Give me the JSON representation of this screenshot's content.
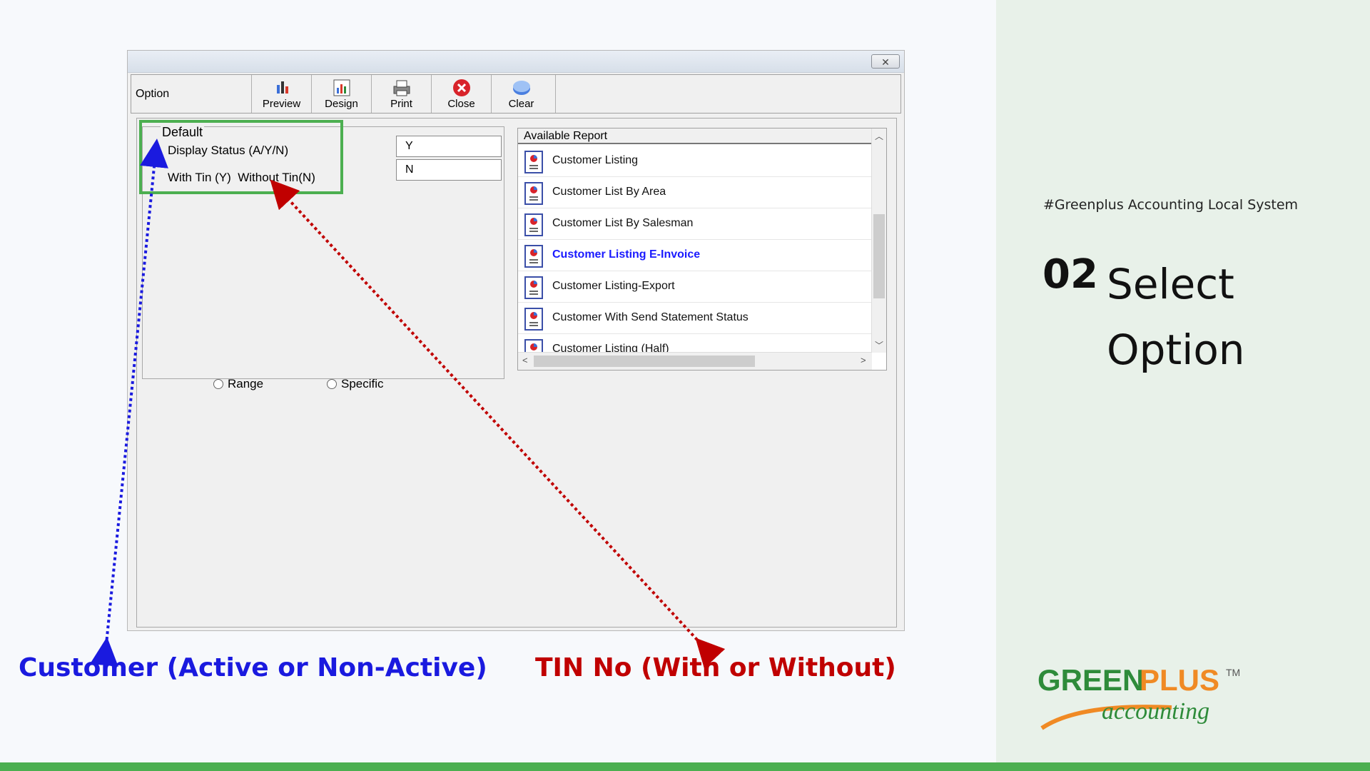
{
  "slide": {
    "hashtag": "#Greenplus Accounting Local System",
    "step_number": "02",
    "step_title_line1": "Select",
    "step_title_line2": "Option",
    "logo_brand_green": "GREEN",
    "logo_brand_plus": "PLUS",
    "logo_tm": "TM",
    "logo_subtitle": "accounting",
    "callout_left": "Customer (Active or Non-Active)",
    "callout_right": "TIN No (With or Without)"
  },
  "window": {
    "close_icon": "close-icon"
  },
  "toolbar": {
    "label": "Option",
    "buttons": [
      {
        "label": "Preview",
        "icon": "preview-chart-icon"
      },
      {
        "label": "Design",
        "icon": "design-icon"
      },
      {
        "label": "Print",
        "icon": "printer-icon"
      },
      {
        "label": "Close",
        "icon": "close-red-x-icon"
      },
      {
        "label": "Clear",
        "icon": "clear-icon"
      }
    ]
  },
  "default_group": {
    "legend": "Default",
    "rows": [
      {
        "label": "Display Status (A/Y/N)",
        "value": "Y"
      },
      {
        "label": "With Tin (Y)  Without Tin(N)",
        "value": "N"
      }
    ]
  },
  "report_panel": {
    "header": "Available Report",
    "items": [
      {
        "label": "Customer Listing",
        "selected": false
      },
      {
        "label": "Customer List By Area",
        "selected": false
      },
      {
        "label": "Customer List By Salesman",
        "selected": false
      },
      {
        "label": "Customer Listing E-Invoice",
        "selected": true
      },
      {
        "label": "Customer Listing-Export",
        "selected": false
      },
      {
        "label": "Customer With Send Statement Status",
        "selected": false
      },
      {
        "label": "Customer Listing (Half)",
        "selected": false
      }
    ]
  },
  "radios": {
    "range": "Range",
    "specific": "Specific"
  },
  "colors": {
    "highlight_green": "#4caf50",
    "callout_blue": "#1a1adf",
    "callout_red": "#c00000",
    "selected_report": "#1a1aff"
  }
}
